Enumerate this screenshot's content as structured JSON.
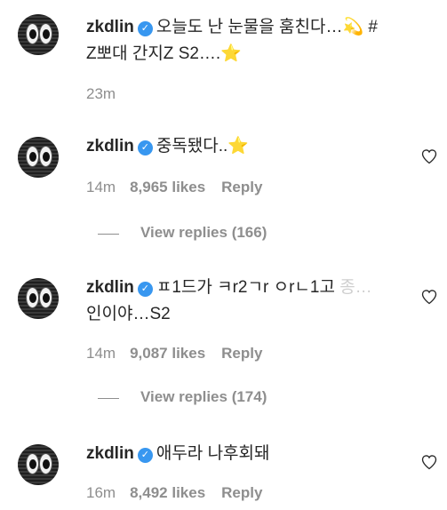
{
  "caption": {
    "username": "zkdlin",
    "text_line1": "오늘도 난 눈물을 훔친다…💫 #",
    "text_line2": "Z뽀대 간지Z S2….⭐",
    "time": "23m"
  },
  "comments": [
    {
      "username": "zkdlin",
      "text": "중독됐다..⭐",
      "time": "14m",
      "likes": "8,965 likes",
      "reply": "Reply",
      "view_replies": "View replies (166)"
    },
    {
      "username": "zkdlin",
      "text_line1": "ㅍ1드가 ㅋr2ㄱr ㅇrㄴ1고 ",
      "text_line1_faded": "종…",
      "text_line2": "인이야…S2",
      "time": "14m",
      "likes": "9,087 likes",
      "reply": "Reply",
      "view_replies": "View replies (174)"
    },
    {
      "username": "zkdlin",
      "text": "애두라 나후회돼",
      "time": "16m",
      "likes": "8,492 likes",
      "reply": "Reply"
    }
  ],
  "icons": {
    "verified": "verified-badge-icon",
    "like": "heart-icon"
  },
  "colors": {
    "verified": "#3897f0",
    "meta": "#8e8e8e",
    "text": "#262626"
  }
}
